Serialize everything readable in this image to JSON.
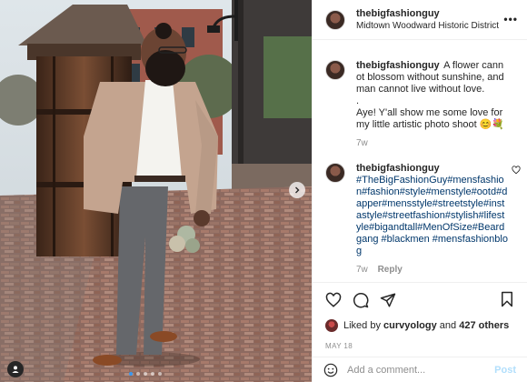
{
  "post": {
    "username": "thebigfashionguy",
    "location": "Midtown Woodward Historic District"
  },
  "caption": {
    "username": "thebigfashionguy",
    "text_line1": "A flower cannot blossom without sunshine, and man cannot live without love.",
    "text_line2": ".",
    "text_line3": "Aye! Y'all show me some love for my little artistic photo shoot 😊💐",
    "age": "7w"
  },
  "comment": {
    "username": "thebigfashionguy",
    "text": "#TheBigFashionGuy#mensfashion#fashion#style#menstyle#ootd#dapper#mensstyle#streetstyle#instastyle#streetfashion#stylish#lifestyle#bigandtall#MenOfSize#Beardgang #blackmen #mensfashionblog",
    "age": "7w",
    "reply_label": "Reply"
  },
  "likes": {
    "prefix": "Liked by",
    "first_user": "curvyology",
    "joiner": "and",
    "others": "427 others"
  },
  "date": "MAY 18",
  "add_comment": {
    "placeholder": "Add a comment...",
    "post_label": "Post"
  },
  "carousel": {
    "slides": 5,
    "active": 0
  },
  "colors": {
    "link": "#00376b",
    "muted": "#8e8e8e",
    "post_disabled": "#b2dffc",
    "carousel_active": "#3897f0"
  },
  "icons": [
    "more-icon",
    "heart-icon",
    "comment-icon",
    "share-icon",
    "bookmark-icon",
    "emoji-icon",
    "chevron-right-icon",
    "user-tag-icon"
  ]
}
